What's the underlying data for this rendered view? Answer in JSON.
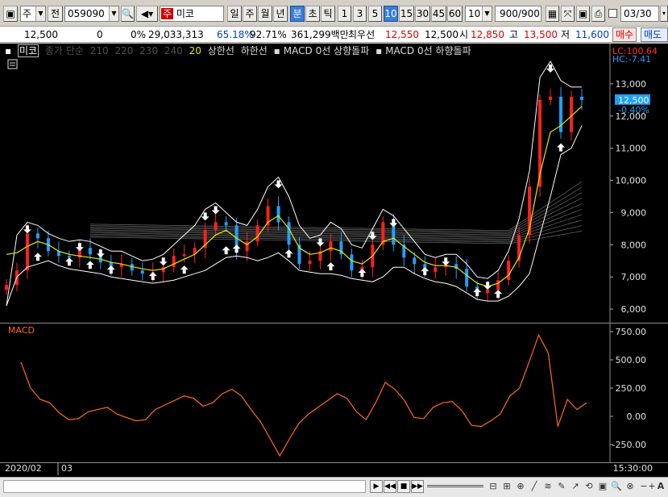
{
  "toolbar": {
    "market_label": "주",
    "view_label": "전",
    "code": "059090",
    "stock_name_prefix": "주",
    "stock_name": "미코",
    "periods": [
      "일",
      "주",
      "월",
      "년",
      "분",
      "초",
      "틱"
    ],
    "active_period": "분",
    "intervals": [
      "1",
      "3",
      "5",
      "10",
      "15",
      "30",
      "45",
      "60"
    ],
    "active_interval": "10",
    "interval_select": "10",
    "count": "900",
    "count_total": "/900",
    "date": "03/30"
  },
  "quote": {
    "price": "12,500",
    "change": "0",
    "change_rate": "0%",
    "volume": "29,033,313",
    "ratio1": "65.18%",
    "ratio2": "92.71%",
    "amount": "361,299백만",
    "high_label": "최우선",
    "best_ask": "12,550",
    "best_bid": "12,500",
    "open_label": "시",
    "open": "12,850",
    "hi_label": "고",
    "hi": "13,500",
    "lo_label": "저",
    "lo": "11,600",
    "buy_label": "매수",
    "sell_label": "매도"
  },
  "legend": {
    "name": "미코",
    "ma_label": "종가 단순",
    "ma_periods_dim": [
      "210",
      "220",
      "230",
      "240"
    ],
    "ma_period_yellow": "20",
    "upper": "상한선",
    "lower": "하한선",
    "macd_up": "MACD 0선 상향돌파",
    "macd_down": "MACD 0선 하향돌파"
  },
  "price_axis": {
    "ticks": [
      "13,000",
      "12,000",
      "11,000",
      "10,000",
      "9,000",
      "8,000",
      "7,000",
      "6,000"
    ],
    "current": "12,500",
    "current_pct": "-0.40%",
    "lc": "LC:100.64",
    "hc": "HC:-7.41"
  },
  "macd_panel": {
    "title": "MACD",
    "ticks": [
      "750.00",
      "500.00",
      "250.00",
      "0.00",
      "-250.00"
    ]
  },
  "time_axis": {
    "start": "2020/02",
    "mark": "03",
    "end": "15:30:00"
  },
  "colors": {
    "up": "#ff2020",
    "down": "#20a0ff",
    "ma20": "#e8e800",
    "band": "#ffffff",
    "macd": "#ff6a1a",
    "current_bg": "#1ea0ff"
  },
  "chart_data": [
    {
      "type": "line",
      "title": "",
      "ylabel": "",
      "ylim": [
        5600,
        13800
      ],
      "series": [
        {
          "values": [
            6750,
            7200,
            8350,
            8200,
            7800,
            7650,
            7600,
            7900,
            7700,
            7450,
            7300,
            7400,
            7200,
            7100,
            7150,
            7300,
            7650,
            7700,
            7900,
            8450,
            8700,
            8600,
            7800,
            8100,
            8600,
            9200,
            8700,
            8000,
            7400,
            7500,
            7800,
            8100,
            7700,
            7200,
            7300,
            8000,
            8700,
            8000,
            7600,
            7400,
            7150,
            7300,
            7400,
            7250,
            6700,
            6500,
            6600,
            6900,
            7500,
            8300,
            9800,
            12500,
            12600,
            11500,
            12600,
            12500
          ]
        },
        {
          "name": "20",
          "values": [
            7700,
            7750,
            7950,
            8100,
            8000,
            7800,
            7700,
            7650,
            7600,
            7550,
            7450,
            7400,
            7320,
            7250,
            7200,
            7250,
            7400,
            7550,
            7700,
            8000,
            8300,
            8450,
            8200,
            8000,
            8250,
            8700,
            8900,
            8500,
            7900,
            7700,
            7750,
            7900,
            7800,
            7500,
            7400,
            7650,
            8100,
            8200,
            7950,
            7700,
            7450,
            7350,
            7350,
            7300,
            7050,
            6800,
            6700,
            6800,
            7050,
            7600,
            8500,
            10200,
            11500,
            11700,
            12000,
            12300
          ]
        },
        {
          "name": "상한선",
          "values": [
            6100,
            8300,
            8700,
            8600,
            8350,
            8200,
            8100,
            8150,
            8100,
            7950,
            7800,
            7800,
            7650,
            7500,
            7550,
            7700,
            8000,
            8300,
            8600,
            9100,
            9300,
            9000,
            8700,
            8600,
            9100,
            9800,
            10100,
            9500,
            8600,
            8200,
            8300,
            8700,
            8500,
            8000,
            7900,
            8500,
            9100,
            8900,
            8500,
            8100,
            7700,
            7600,
            7700,
            7700,
            7400,
            7000,
            6950,
            7200,
            7800,
            8800,
            10300,
            13200,
            13700,
            13100,
            12900,
            12900
          ]
        },
        {
          "name": "하한선",
          "values": [
            6100,
            7000,
            7300,
            7400,
            7500,
            7350,
            7250,
            7200,
            7150,
            7100,
            7000,
            6950,
            6900,
            6850,
            6800,
            6850,
            6900,
            7000,
            7100,
            7200,
            7400,
            7600,
            7650,
            7600,
            7500,
            7600,
            7750,
            7500,
            7200,
            7150,
            7100,
            7100,
            7050,
            6950,
            6900,
            6850,
            7000,
            7300,
            7300,
            7100,
            6950,
            6850,
            6800,
            6700,
            6500,
            6300,
            6250,
            6250,
            6400,
            6700,
            7100,
            8300,
            9500,
            10800,
            11000,
            11700
          ]
        }
      ]
    },
    {
      "type": "line",
      "title": "MACD",
      "ylim": [
        -400,
        800
      ],
      "series": [
        {
          "name": "MACD",
          "values": [
            480,
            250,
            150,
            120,
            30,
            -30,
            -20,
            40,
            60,
            80,
            20,
            -10,
            -40,
            -30,
            60,
            100,
            140,
            180,
            160,
            90,
            120,
            200,
            240,
            180,
            60,
            -50,
            -200,
            -350,
            -200,
            -60,
            20,
            80,
            140,
            200,
            160,
            40,
            -30,
            120,
            300,
            240,
            140,
            -10,
            -20,
            80,
            120,
            130,
            50,
            -80,
            -90,
            -40,
            20,
            180,
            250,
            480,
            720,
            560,
            -90,
            150,
            60,
            120
          ]
        }
      ]
    }
  ]
}
